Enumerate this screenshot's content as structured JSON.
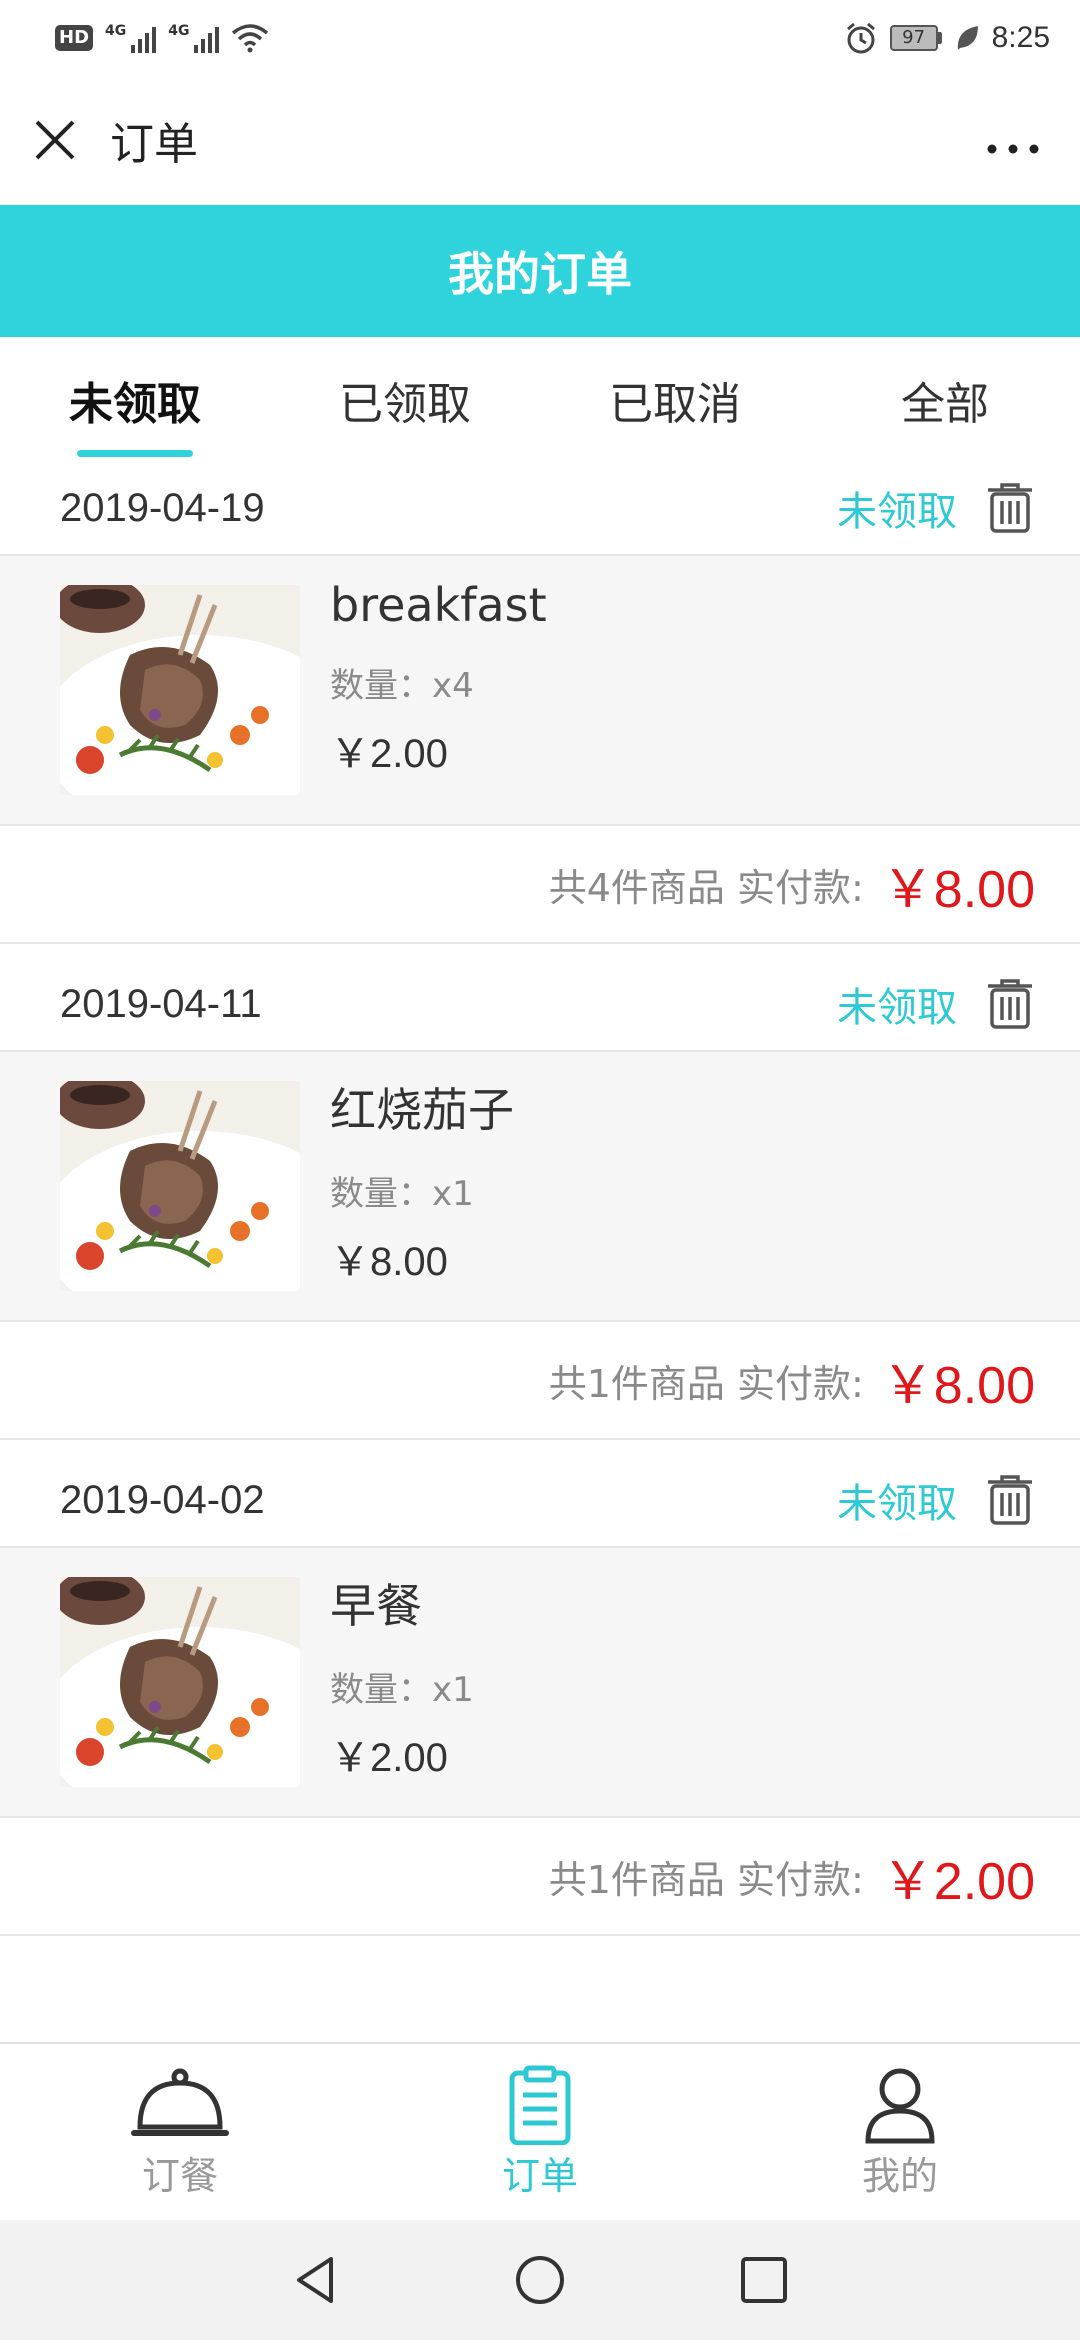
{
  "status_bar": {
    "hd": "HD",
    "network_1": "4G",
    "network_2": "4G",
    "battery": "97",
    "time": "8:25"
  },
  "title_bar": {
    "title": "订单",
    "close_icon": "close-icon",
    "more_label": "···"
  },
  "header": {
    "title": "我的订单",
    "bg_color": "#2ed3dc"
  },
  "tabs": [
    {
      "label": "未领取",
      "active": true
    },
    {
      "label": "已领取",
      "active": false
    },
    {
      "label": "已取消",
      "active": false
    },
    {
      "label": "全部",
      "active": false
    }
  ],
  "orders": [
    {
      "date": "2019-04-19",
      "status": "未领取",
      "item": {
        "name": "breakfast",
        "qty": "数量：x4",
        "price": "￥2.00"
      },
      "summary": "共4件商品 实付款:",
      "total": "￥8.00"
    },
    {
      "date": "2019-04-11",
      "status": "未领取",
      "item": {
        "name": "红烧茄子",
        "qty": "数量：x1",
        "price": "￥8.00"
      },
      "summary": "共1件商品 实付款:",
      "total": "￥8.00"
    },
    {
      "date": "2019-04-02",
      "status": "未领取",
      "item": {
        "name": "早餐",
        "qty": "数量：x1",
        "price": "￥2.00"
      },
      "summary": "共1件商品 实付款:",
      "total": "￥2.00"
    }
  ],
  "bottom_nav": [
    {
      "label": "订餐",
      "icon": "cloche-icon",
      "active": false
    },
    {
      "label": "订单",
      "icon": "clipboard-icon",
      "active": true
    },
    {
      "label": "我的",
      "icon": "user-icon",
      "active": false
    }
  ],
  "colors": {
    "accent": "#2ed3dc",
    "price_red": "#e0171b",
    "status_teal": "#2ecad3"
  }
}
